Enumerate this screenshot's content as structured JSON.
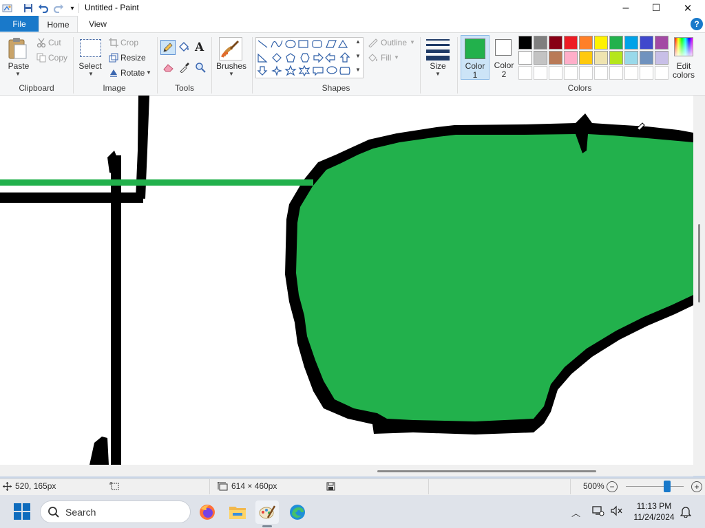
{
  "window": {
    "title": "Untitled - Paint",
    "minimize_label": "–",
    "maximize_label": "☐",
    "close_label": "✕"
  },
  "quick_access": {
    "customize_label": "▾"
  },
  "tabs": {
    "file": "File",
    "home": "Home",
    "view": "View",
    "help": "?"
  },
  "ribbon": {
    "clipboard": {
      "group_label": "Clipboard",
      "paste": "Paste",
      "cut": "Cut",
      "copy": "Copy"
    },
    "image": {
      "group_label": "Image",
      "select": "Select",
      "crop": "Crop",
      "resize": "Resize",
      "rotate": "Rotate"
    },
    "tools": {
      "group_label": "Tools"
    },
    "brushes": {
      "label": "Brushes"
    },
    "shapes": {
      "group_label": "Shapes",
      "outline": "Outline",
      "fill": "Fill"
    },
    "size": {
      "label": "Size"
    },
    "color1": {
      "label_line1": "Color",
      "label_line2": "1",
      "value": "#22b14c"
    },
    "color2": {
      "label_line1": "Color",
      "label_line2": "2",
      "value": "#ffffff"
    },
    "colors": {
      "group_label": "Colors",
      "edit_line1": "Edit",
      "edit_line2": "colors",
      "palette_row1": [
        "#000000",
        "#7f7f7f",
        "#880015",
        "#ed1c24",
        "#ff7f27",
        "#fff200",
        "#22b14c",
        "#00a2e8",
        "#3f48cc",
        "#a349a4"
      ],
      "palette_row2": [
        "#ffffff",
        "#c3c3c3",
        "#b97a57",
        "#ffaec9",
        "#ffc90e",
        "#efe4b0",
        "#b5e61d",
        "#99d9ea",
        "#7092be",
        "#c8bfe7"
      ]
    }
  },
  "status": {
    "cursor_pos": "520, 165px",
    "image_size": "614 × 460px",
    "zoom": "500%",
    "zoom_minus": "−",
    "zoom_plus": "+",
    "zoom_level": 0.72
  },
  "taskbar": {
    "search_label": "Search",
    "time": "11:13 PM",
    "date": "11/24/2024"
  },
  "colors": {
    "accent": "#1979ca",
    "paint_green": "#22b14c",
    "ink": "#000000"
  }
}
